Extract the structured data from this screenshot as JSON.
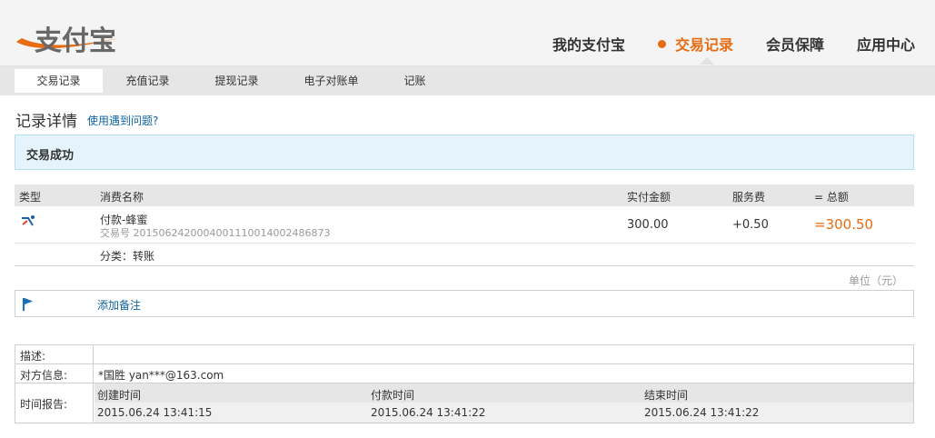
{
  "header": {
    "logo_text": "支付宝",
    "nav": [
      {
        "label": "我的支付宝",
        "active": false
      },
      {
        "label": "交易记录",
        "active": true
      },
      {
        "label": "会员保障",
        "active": false
      },
      {
        "label": "应用中心",
        "active": false
      }
    ]
  },
  "subnav": [
    {
      "label": "交易记录",
      "active": true
    },
    {
      "label": "充值记录",
      "active": false
    },
    {
      "label": "提现记录",
      "active": false
    },
    {
      "label": "电子对账单",
      "active": false
    },
    {
      "label": "记账",
      "active": false
    }
  ],
  "record": {
    "title": "记录详情",
    "help_link": "使用遇到问题?",
    "status": "交易成功"
  },
  "table": {
    "headers": {
      "type": "类型",
      "name": "消费名称",
      "paid": "实付金额",
      "fee": "服务费",
      "total": "= 总额"
    },
    "row": {
      "type_icon": "transfer-icon",
      "name": "付款-蜂蜜",
      "trade_no": "交易号 2015062420004001110014002486873",
      "paid": "300.00",
      "fee": "+0.50",
      "total": "=300.50",
      "category": "分类：转账"
    },
    "unit": "单位（元）"
  },
  "remark": {
    "icon": "flag-icon",
    "link": "添加备注"
  },
  "info": {
    "desc_label": "描述:",
    "desc_value": "",
    "party_label": "对方信息:",
    "party_value": "*国胜 yan***@163.com",
    "time_label": "时间报告:",
    "time_headers": [
      "创建时间",
      "付款时间",
      "结束时间"
    ],
    "time_values": [
      "2015.06.24 13:41:15",
      "2015.06.24 13:41:22",
      "2015.06.24 13:41:22"
    ]
  },
  "colors": {
    "accent": "#e86c11",
    "link": "#0f64a5",
    "success_bg": "#e5f3fc"
  }
}
